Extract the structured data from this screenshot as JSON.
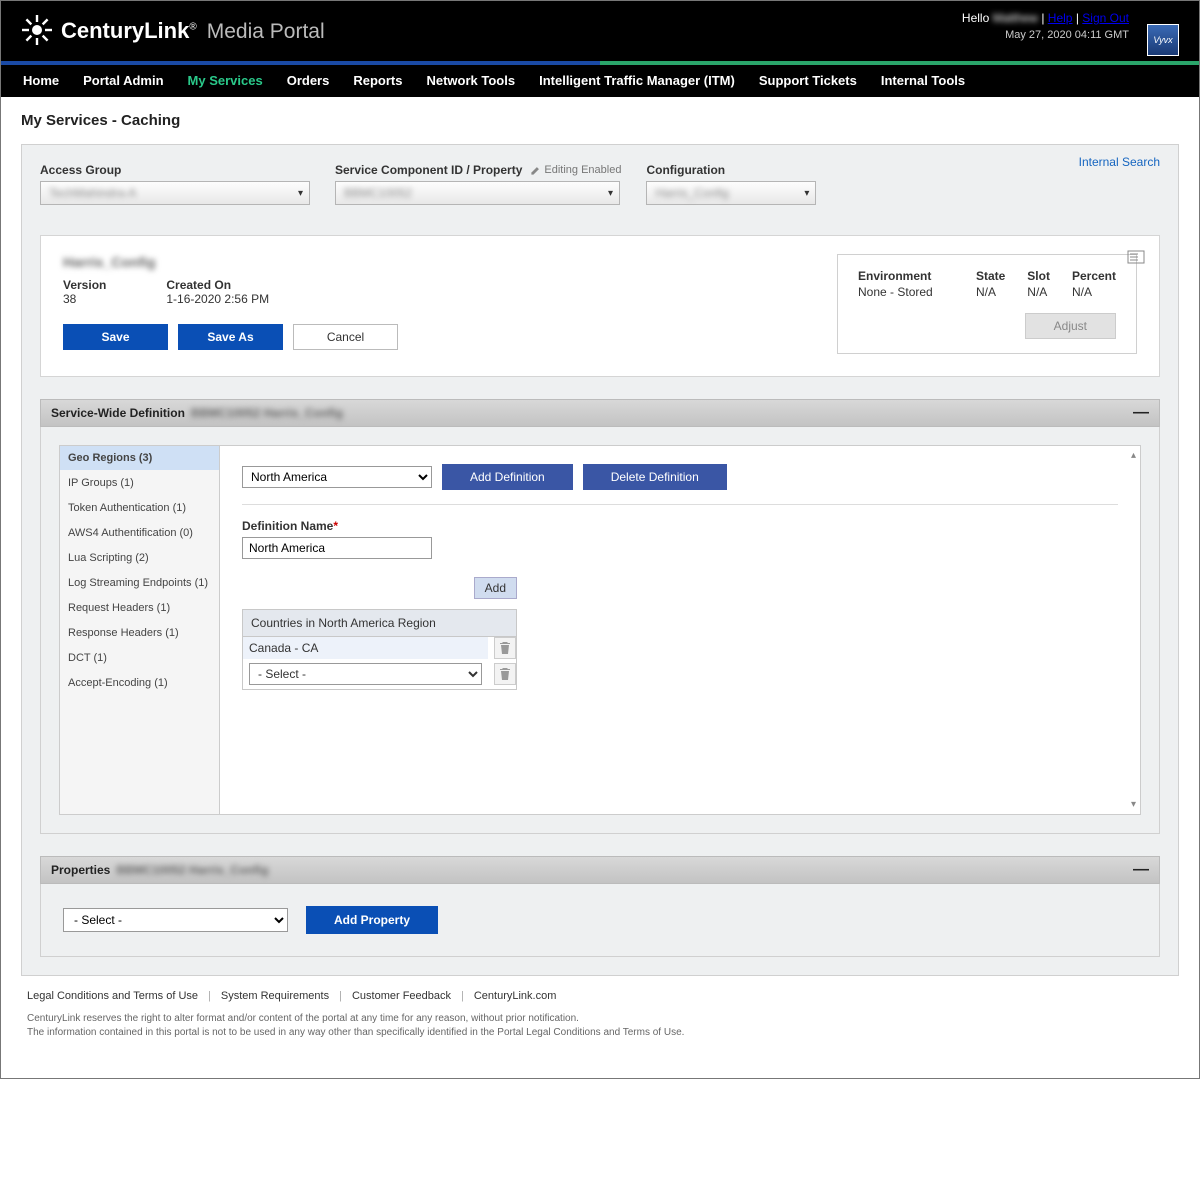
{
  "header": {
    "brand_main": "CenturyLink",
    "brand_sub": "Media Portal",
    "hello_prefix": "Hello",
    "hello_user": "Matthew",
    "help": "Help",
    "signout": "Sign Out",
    "datetime": "May 27, 2020 04:11 GMT",
    "vyvx": "Vyvx"
  },
  "nav": {
    "items": [
      "Home",
      "Portal Admin",
      "My Services",
      "Orders",
      "Reports",
      "Network Tools",
      "Intelligent Traffic Manager (ITM)",
      "Support Tickets",
      "Internal Tools"
    ],
    "active_index": 2
  },
  "page": {
    "title": "My Services - Caching",
    "internal_search": "Internal Search"
  },
  "selectors": {
    "access_group_label": "Access Group",
    "access_group_value": "TechMahindra-A",
    "scid_label": "Service Component ID / Property",
    "scid_value": "BBMC10052",
    "editing_enabled": "Editing Enabled",
    "config_label": "Configuration",
    "config_value": "Harris_Config"
  },
  "summary": {
    "config_name": "Harris_Config",
    "version_label": "Version",
    "version_value": "38",
    "created_label": "Created On",
    "created_value": "1-16-2020 2:56 PM",
    "save": "Save",
    "save_as": "Save As",
    "cancel": "Cancel"
  },
  "env": {
    "headers": {
      "environment": "Environment",
      "state": "State",
      "slot": "Slot",
      "percent": "Percent"
    },
    "values": {
      "environment": "None - Stored",
      "state": "N/A",
      "slot": "N/A",
      "percent": "N/A"
    },
    "adjust": "Adjust"
  },
  "swd": {
    "title": "Service-Wide Definition",
    "blur_after": "BBMC10052   Harris_Config",
    "sidebar": [
      "Geo Regions (3)",
      "IP Groups (1)",
      "Token Authentication (1)",
      "AWS4 Authentification (0)",
      "Lua Scripting (2)",
      "Log Streaming Endpoints (1)",
      "Request Headers (1)",
      "Response Headers (1)",
      "DCT (1)",
      "Accept-Encoding (1)"
    ],
    "active_sidebar": 0,
    "def_select_value": "North America",
    "add_definition": "Add Definition",
    "delete_definition": "Delete Definition",
    "def_name_label": "Definition Name",
    "def_name_value": "North America",
    "add_btn": "Add",
    "countries_header": "Countries in North America Region",
    "country_row_value": "Canada - CA",
    "country_select_placeholder": "- Select -"
  },
  "props": {
    "title": "Properties",
    "blur_after": "BBMC10052   Harris_Config",
    "select_placeholder": "- Select -",
    "add_property": "Add Property"
  },
  "footer": {
    "links": [
      "Legal Conditions and Terms of Use",
      "System Requirements",
      "Customer Feedback",
      "CenturyLink.com"
    ],
    "disc1": "CenturyLink reserves the right to alter format and/or content of the portal at any time for any reason, without prior notification.",
    "disc2": "The information contained in this portal is not to be used in any way other than specifically identified in the Portal Legal Conditions and Terms of Use."
  }
}
